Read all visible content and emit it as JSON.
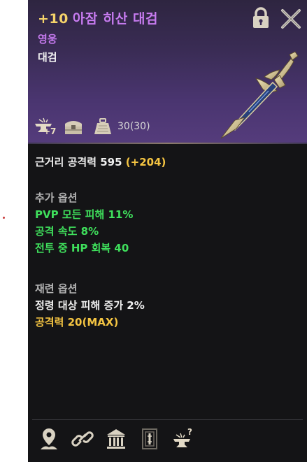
{
  "header": {
    "enhance_level": "+10",
    "item_name": "아잠 히산 대검",
    "grade": "영웅",
    "item_type": "대검",
    "enhance_badge": "+7",
    "weight_text": "30(30)"
  },
  "stats": {
    "main_stat_label": "근거리 공격력 595",
    "main_stat_bonus": "(+204)"
  },
  "additional_options": {
    "title": "추가 옵션",
    "items": [
      "PVP 모든 피해 11%",
      "공격 속도 8%",
      "전투 중 HP 회복 40"
    ]
  },
  "reforge_options": {
    "title": "재련 옵션",
    "items": [
      "정령 대상 피해 증가 2%",
      "공격력 20(MAX)"
    ]
  },
  "icons": {
    "header": [
      "lock-icon",
      "close-icon"
    ],
    "status": [
      "anvil-enhance-icon",
      "chest-icon",
      "weight-icon"
    ],
    "footer": [
      "location-pin-icon",
      "link-icon",
      "bank-icon",
      "book-icon",
      "anvil-question-icon"
    ]
  },
  "colors": {
    "enhance": "#f5d36a",
    "hero_grade": "#c77bf0",
    "option_green": "#3fe05c",
    "bonus_gold": "#f5c542"
  }
}
